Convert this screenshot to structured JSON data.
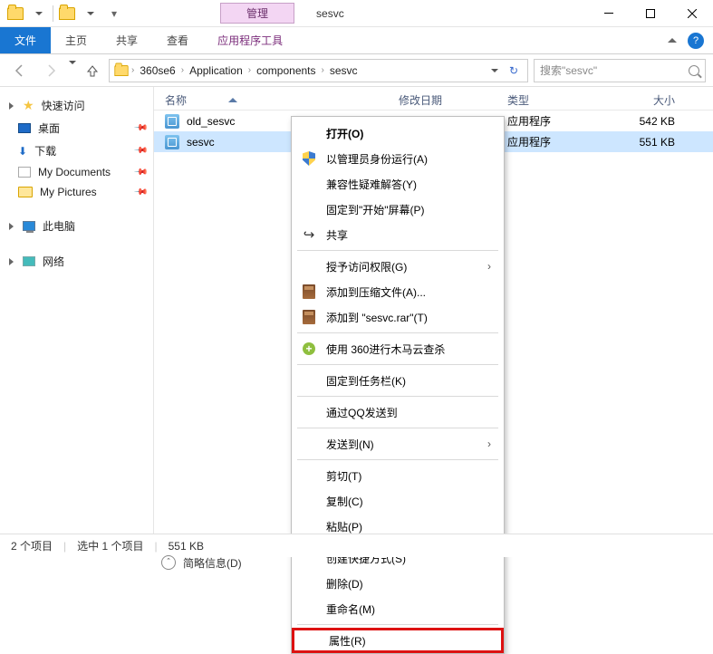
{
  "titlebar": {
    "mgmt_label": "管理",
    "title": "sesvc"
  },
  "ribbon": {
    "file": "文件",
    "home": "主页",
    "share": "共享",
    "view": "查看",
    "app_tools": "应用程序工具"
  },
  "nav": {
    "breadcrumb": [
      "360se6",
      "Application",
      "components",
      "sesvc"
    ],
    "search_placeholder": "搜索\"sesvc\""
  },
  "sidebar": {
    "quick": "快速访问",
    "desktop": "桌面",
    "downloads": "下载",
    "my_documents": "My Documents",
    "my_pictures": "My Pictures",
    "this_pc": "此电脑",
    "network": "网络"
  },
  "columns": {
    "name": "名称",
    "date": "修改日期",
    "type": "类型",
    "size": "大小"
  },
  "rows": [
    {
      "name": "old_sesvc",
      "type": "应用程序",
      "size": "542 KB",
      "selected": false
    },
    {
      "name": "sesvc",
      "type": "应用程序",
      "size": "551 KB",
      "selected": true
    }
  ],
  "context_menu": {
    "open": "打开(O)",
    "run_as_admin": "以管理员身份运行(A)",
    "compat_troubleshoot": "兼容性疑难解答(Y)",
    "pin_start": "固定到\"开始\"屏幕(P)",
    "share": "共享",
    "grant_access": "授予访问权限(G)",
    "add_to_archive": "添加到压缩文件(A)...",
    "add_to_rar": "添加到 \"sesvc.rar\"(T)",
    "scan_360": "使用 360进行木马云查杀",
    "pin_taskbar": "固定到任务栏(K)",
    "qq_send": "通过QQ发送到",
    "send_to": "发送到(N)",
    "cut": "剪切(T)",
    "copy": "复制(C)",
    "paste": "粘贴(P)",
    "create_shortcut": "创建快捷方式(S)",
    "delete": "删除(D)",
    "rename": "重命名(M)",
    "properties": "属性(R)"
  },
  "status": {
    "items": "2 个项目",
    "selected": "选中 1 个项目",
    "size": "551 KB"
  },
  "infobar": {
    "brief": "简略信息(D)"
  }
}
